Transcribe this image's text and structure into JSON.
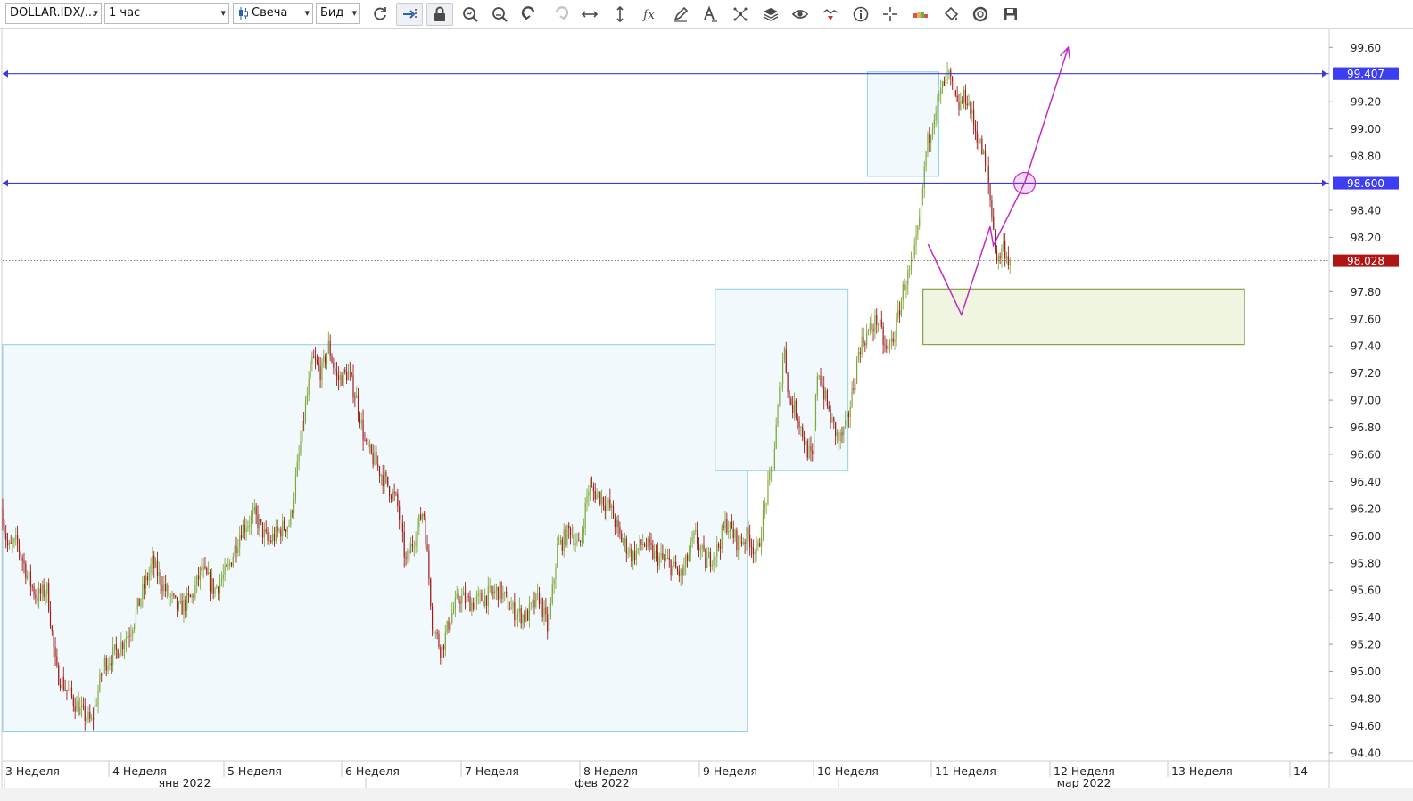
{
  "toolbar": {
    "instrument": "DOLLAR.IDX/...",
    "timeframe": "1 час",
    "chart_type": "Свеча",
    "price_side": "Бид",
    "icons": [
      "refresh-icon",
      "shift-right-icon",
      "lock-icon",
      "zoom-in-icon",
      "zoom-out-icon",
      "undo-icon",
      "redo-icon",
      "fit-horizontal-icon",
      "fit-vertical-icon",
      "indicators-fx-icon",
      "pencil-icon",
      "text-tool-icon",
      "pattern-tool-icon",
      "layers-icon",
      "eye-icon",
      "signals-icon",
      "info-icon",
      "crosshair-icon",
      "heatmap-icon",
      "paint-bucket-icon",
      "template-icon",
      "save-icon"
    ]
  },
  "colors": {
    "up": "#7fa83a",
    "down": "#9e1c1c",
    "hline": "#3b3bdc",
    "price_tag": "#b01515",
    "arrow": "#c22cc2",
    "zone_fill": "#f2f9fc",
    "zone_border": "#8fd0e4",
    "target_fill": "#eff5e1",
    "target_border": "#6d9126"
  },
  "chart_data": {
    "type": "candlestick",
    "instrument": "DOLLAR.IDX",
    "interval": "1 час",
    "y_ticks": [
      "99.60",
      "99.20",
      "99.00",
      "98.80",
      "98.40",
      "98.20",
      "97.80",
      "97.60",
      "97.40",
      "97.20",
      "97.00",
      "96.80",
      "96.60",
      "96.40",
      "96.20",
      "96.00",
      "95.80",
      "95.60",
      "95.40",
      "95.20",
      "95.00",
      "94.80",
      "94.60",
      "94.40"
    ],
    "ylim": [
      94.34,
      99.74
    ],
    "x_ticks": [
      "3 Неделя",
      "4 Неделя",
      "5 Неделя",
      "6 Неделя",
      "7 Неделя",
      "8 Неделя",
      "9 Неделя",
      "10 Неделя",
      "11 Неделя",
      "12 Неделя",
      "13 Неделя",
      "14"
    ],
    "x_months": [
      "янв 2022",
      "фев 2022",
      "мар 2022"
    ],
    "horizontal_lines": [
      {
        "label": "99.407",
        "value": 99.407
      },
      {
        "label": "98.600",
        "value": 98.6
      }
    ],
    "current_price": {
      "label": "98.028",
      "value": 98.028
    },
    "path": [
      [
        0,
        96.2
      ],
      [
        8,
        95.9
      ],
      [
        18,
        95.95
      ],
      [
        30,
        95.7
      ],
      [
        40,
        95.55
      ],
      [
        52,
        95.6
      ],
      [
        62,
        95.0
      ],
      [
        75,
        94.85
      ],
      [
        90,
        94.7
      ],
      [
        102,
        94.62
      ],
      [
        115,
        95.05
      ],
      [
        130,
        95.15
      ],
      [
        145,
        95.3
      ],
      [
        160,
        95.6
      ],
      [
        170,
        95.8
      ],
      [
        185,
        95.6
      ],
      [
        200,
        95.45
      ],
      [
        215,
        95.55
      ],
      [
        225,
        95.75
      ],
      [
        240,
        95.6
      ],
      [
        255,
        95.75
      ],
      [
        270,
        96.05
      ],
      [
        285,
        96.15
      ],
      [
        300,
        95.95
      ],
      [
        315,
        96.05
      ],
      [
        325,
        96.1
      ],
      [
        340,
        96.85
      ],
      [
        350,
        97.3
      ],
      [
        360,
        97.2
      ],
      [
        368,
        97.4
      ],
      [
        378,
        97.15
      ],
      [
        390,
        97.2
      ],
      [
        400,
        97.0
      ],
      [
        410,
        96.65
      ],
      [
        420,
        96.55
      ],
      [
        432,
        96.4
      ],
      [
        445,
        96.25
      ],
      [
        455,
        95.8
      ],
      [
        465,
        96.0
      ],
      [
        475,
        96.2
      ],
      [
        485,
        95.35
      ],
      [
        495,
        95.15
      ],
      [
        505,
        95.4
      ],
      [
        515,
        95.55
      ],
      [
        530,
        95.5
      ],
      [
        545,
        95.55
      ],
      [
        560,
        95.6
      ],
      [
        575,
        95.45
      ],
      [
        590,
        95.4
      ],
      [
        605,
        95.55
      ],
      [
        615,
        95.3
      ],
      [
        625,
        95.9
      ],
      [
        640,
        96.05
      ],
      [
        650,
        95.9
      ],
      [
        660,
        96.35
      ],
      [
        672,
        96.3
      ],
      [
        685,
        96.2
      ],
      [
        695,
        96.0
      ],
      [
        710,
        95.85
      ],
      [
        722,
        95.95
      ],
      [
        735,
        95.85
      ],
      [
        750,
        95.8
      ],
      [
        765,
        95.7
      ],
      [
        780,
        96.0
      ],
      [
        792,
        95.8
      ],
      [
        805,
        95.9
      ],
      [
        815,
        96.1
      ],
      [
        828,
        95.95
      ],
      [
        840,
        96.0
      ],
      [
        850,
        95.85
      ],
      [
        858,
        96.2
      ],
      [
        868,
        96.55
      ],
      [
        875,
        97.05
      ],
      [
        880,
        97.4
      ],
      [
        886,
        97.0
      ],
      [
        895,
        96.9
      ],
      [
        905,
        96.65
      ],
      [
        912,
        96.55
      ],
      [
        918,
        97.25
      ],
      [
        925,
        97.05
      ],
      [
        933,
        96.85
      ],
      [
        942,
        96.7
      ],
      [
        950,
        96.8
      ],
      [
        958,
        97.1
      ],
      [
        965,
        97.4
      ],
      [
        975,
        97.5
      ],
      [
        985,
        97.6
      ],
      [
        995,
        97.35
      ],
      [
        1005,
        97.5
      ],
      [
        1015,
        97.85
      ],
      [
        1025,
        98.0
      ],
      [
        1033,
        98.35
      ],
      [
        1040,
        98.85
      ],
      [
        1048,
        99.1
      ],
      [
        1058,
        99.3
      ],
      [
        1065,
        99.4
      ],
      [
        1075,
        99.15
      ],
      [
        1085,
        99.25
      ],
      [
        1095,
        99.0
      ],
      [
        1102,
        98.85
      ],
      [
        1108,
        98.7
      ],
      [
        1114,
        98.35
      ],
      [
        1120,
        98.0
      ],
      [
        1126,
        98.15
      ],
      [
        1133,
        98.03
      ]
    ],
    "zones": [
      {
        "x0": 0.0,
        "x1": 0.5614,
        "top": 97.41,
        "bottom": 94.56
      },
      {
        "x0": 0.5372,
        "x1": 0.6373,
        "top": 97.82,
        "bottom": 96.48
      },
      {
        "x0": 0.6519,
        "x1": 0.7058,
        "top": 99.42,
        "bottom": 98.65
      }
    ],
    "target_zone": {
      "x0": 0.6938,
      "x1": 0.9362,
      "top": 97.82,
      "bottom": 97.41
    },
    "projection": [
      [
        0.6976,
        98.15
      ],
      [
        0.7228,
        97.63
      ],
      [
        0.7444,
        98.28
      ],
      [
        0.7469,
        98.14
      ],
      [
        0.7704,
        98.6
      ],
      [
        0.8033,
        99.6
      ]
    ],
    "circle_marker": {
      "x": 0.7704,
      "value": 98.6
    }
  }
}
